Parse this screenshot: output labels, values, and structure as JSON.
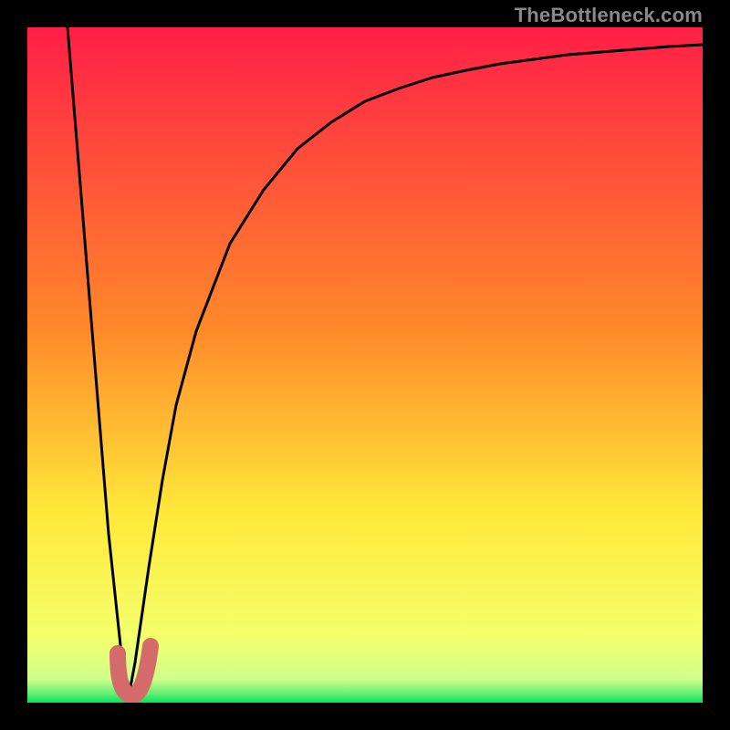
{
  "watermark": "TheBottleneck.com",
  "colors": {
    "top": "#ff1f47",
    "mid_upper": "#ff8a2a",
    "mid": "#ffe93a",
    "lower": "#f4ff6a",
    "green": "#00e65b",
    "curve": "#000000",
    "marker": "#d46a6a",
    "frame": "#000000"
  },
  "chart_data": {
    "type": "line",
    "title": "",
    "xlabel": "",
    "ylabel": "",
    "xlim": [
      0,
      100
    ],
    "ylim": [
      0,
      100
    ],
    "series": [
      {
        "name": "bottleneck-curve",
        "x": [
          6,
          8,
          10,
          12,
          14,
          15,
          16,
          18,
          20,
          22,
          25,
          30,
          35,
          40,
          45,
          50,
          55,
          60,
          65,
          70,
          75,
          80,
          85,
          90,
          95,
          100
        ],
        "values": [
          100,
          75,
          50,
          25,
          6,
          1,
          6,
          20,
          33,
          44,
          55,
          68,
          76,
          82,
          86,
          89,
          91,
          92.5,
          93.7,
          94.6,
          95.3,
          95.9,
          96.4,
          96.8,
          97.1,
          97.4
        ]
      }
    ],
    "marker": {
      "name": "optimal-point",
      "x_range": [
        14,
        18
      ],
      "y_range": [
        0,
        10
      ]
    },
    "background_gradient_stops": [
      {
        "pos": 0.0,
        "color": "#ff1f47"
      },
      {
        "pos": 0.45,
        "color": "#ff8a2a"
      },
      {
        "pos": 0.72,
        "color": "#ffe93a"
      },
      {
        "pos": 0.9,
        "color": "#f4ff6a"
      },
      {
        "pos": 0.965,
        "color": "#cfff8a"
      },
      {
        "pos": 0.985,
        "color": "#6fef76"
      },
      {
        "pos": 1.0,
        "color": "#00e65b"
      }
    ]
  }
}
